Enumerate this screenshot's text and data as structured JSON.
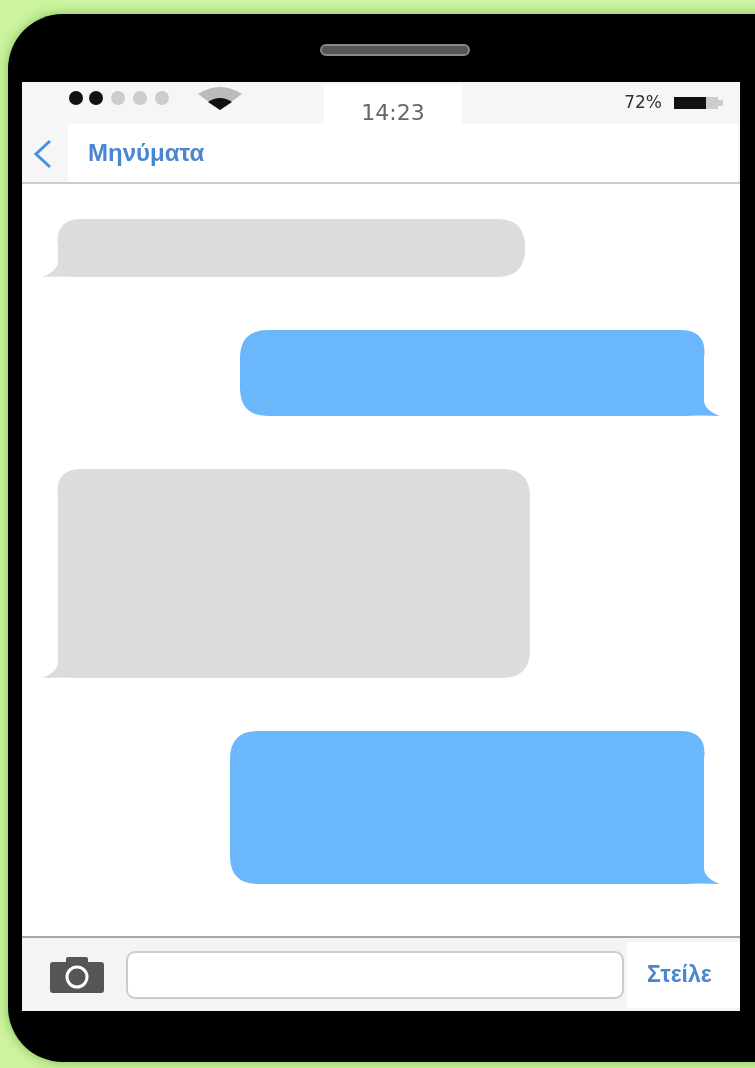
{
  "status_bar": {
    "time": "14:23",
    "battery": "72%"
  },
  "header": {
    "title": "Μηνύματα"
  },
  "messages": [
    {
      "kind": "received"
    },
    {
      "kind": "sent"
    },
    {
      "kind": "received"
    },
    {
      "kind": "sent"
    }
  ],
  "composer": {
    "send": "Στείλε"
  }
}
